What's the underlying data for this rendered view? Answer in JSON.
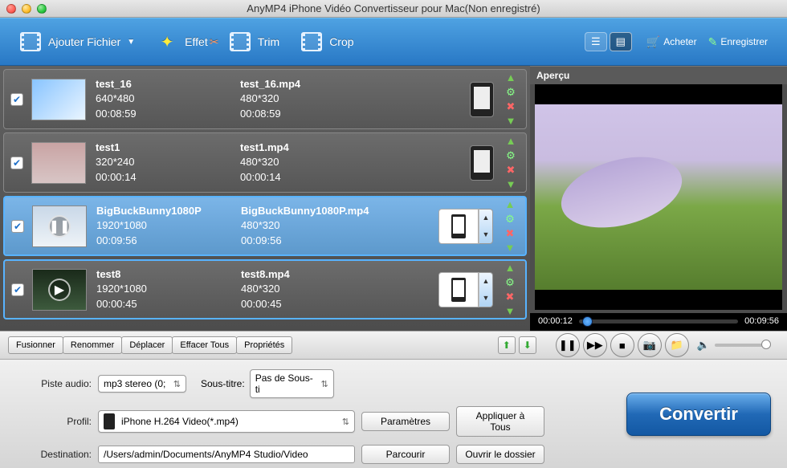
{
  "window": {
    "title": "AnyMP4 iPhone Vidéo Convertisseur pour Mac(Non enregistré)"
  },
  "toolbar": {
    "add_file": "Ajouter Fichier",
    "effect": "Effet",
    "trim": "Trim",
    "crop": "Crop",
    "buy": "Acheter",
    "register": "Enregistrer"
  },
  "preview": {
    "label": "Aperçu",
    "current_time": "00:00:12",
    "total_time": "00:09:56"
  },
  "files": [
    {
      "checked": true,
      "name": "test_16",
      "src_res": "640*480",
      "src_dur": "00:08:59",
      "out_name": "test_16.mp4",
      "out_res": "480*320",
      "out_dur": "00:08:59"
    },
    {
      "checked": true,
      "name": "test1",
      "src_res": "320*240",
      "src_dur": "00:00:14",
      "out_name": "test1.mp4",
      "out_res": "480*320",
      "out_dur": "00:00:14"
    },
    {
      "checked": true,
      "name": "BigBuckBunny1080P",
      "src_res": "1920*1080",
      "src_dur": "00:09:56",
      "out_name": "BigBuckBunny1080P.mp4",
      "out_res": "480*320",
      "out_dur": "00:09:56"
    },
    {
      "checked": true,
      "name": "test8",
      "src_res": "1920*1080",
      "src_dur": "00:00:45",
      "out_name": "test8.mp4",
      "out_res": "480*320",
      "out_dur": "00:00:45"
    }
  ],
  "list_actions": {
    "merge": "Fusionner",
    "rename": "Renommer",
    "move": "Déplacer",
    "clear_all": "Effacer Tous",
    "properties": "Propriétés"
  },
  "form": {
    "audio_track_label": "Piste audio:",
    "audio_track_value": "mp3 stereo (0;",
    "subtitle_label": "Sous-titre:",
    "subtitle_value": "Pas de Sous-ti",
    "profile_label": "Profil:",
    "profile_value": "iPhone H.264 Video(*.mp4)",
    "settings_btn": "Paramètres",
    "apply_all_btn": "Appliquer à Tous",
    "destination_label": "Destination:",
    "destination_value": "/Users/admin/Documents/AnyMP4 Studio/Video",
    "browse_btn": "Parcourir",
    "open_folder_btn": "Ouvrir le dossier",
    "convert_btn": "Convertir"
  }
}
